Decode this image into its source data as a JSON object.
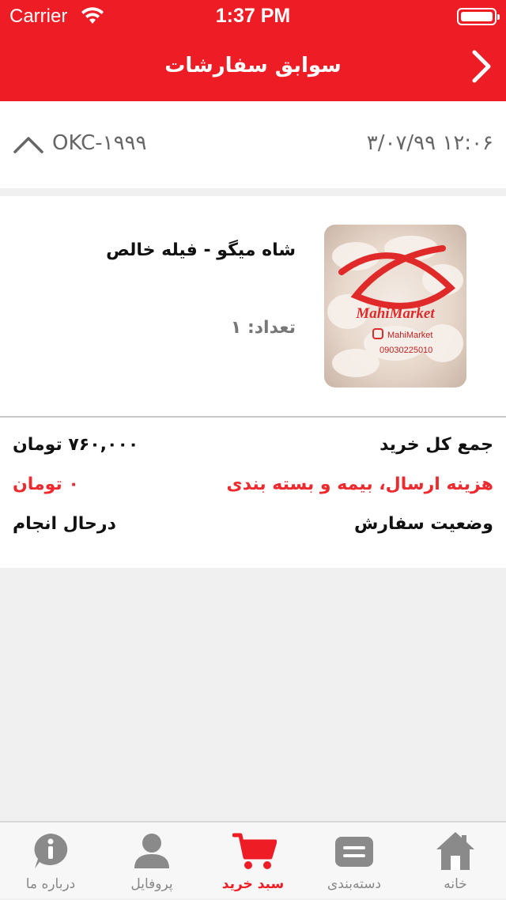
{
  "status_bar": {
    "carrier": "Carrier",
    "time": "1:37 PM"
  },
  "nav": {
    "title": "سوابق سفارشات"
  },
  "order": {
    "code": "OKC-۱۹۹۹",
    "date": "۱۲:۰۶ ۳/۰۷/۹۹"
  },
  "product": {
    "name": "شاه میگو - فیله خالص",
    "quantity": "تعداد: ۱",
    "image_brand_text": "MahiMarket",
    "image_handle_text": "MahiMarket",
    "image_phone_text": "09030225010"
  },
  "summary": {
    "total_label": "جمع کل خرید",
    "total_value": "۷۶۰,۰۰۰ تومان",
    "shipping_label": "هزینه ارسال، بیمه و بسته بندی",
    "shipping_value": "۰ تومان",
    "status_label": "وضعیت سفارش",
    "status_value": "درحال انجام"
  },
  "tabs": [
    {
      "label": "درباره ما",
      "icon": "info-icon"
    },
    {
      "label": "پروفایل",
      "icon": "user-icon"
    },
    {
      "label": "سبد خرید",
      "icon": "cart-icon",
      "active": true
    },
    {
      "label": "دسته‌بندی",
      "icon": "category-icon"
    },
    {
      "label": "خانه",
      "icon": "home-icon"
    }
  ],
  "colors": {
    "brand_red": "#ee1c25",
    "tab_inactive": "#888888"
  }
}
